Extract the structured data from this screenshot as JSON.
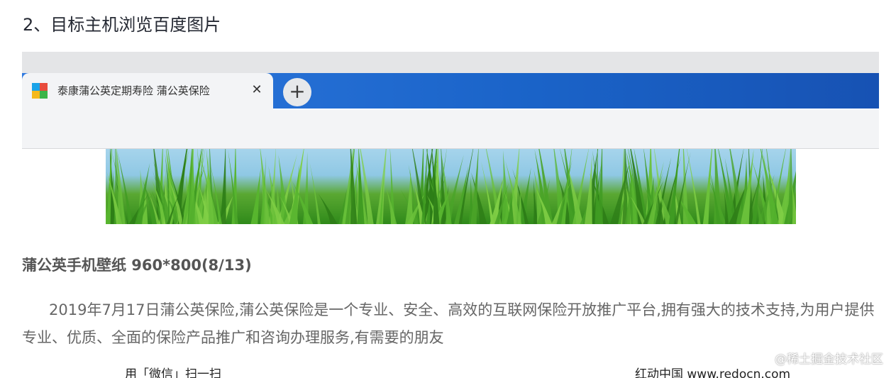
{
  "heading": "2、目标主机浏览百度图片",
  "browser": {
    "tab": {
      "title": "泰康蒲公英定期寿险 蒲公英保险",
      "close_glyph": "✕",
      "favicon_colors": [
        "#1aa3e8",
        "#e84c3d",
        "#f6b91b",
        "#3bb549"
      ]
    },
    "new_tab_glyph": "+",
    "colors": {
      "tabbar": "#1f6ad2",
      "toolbar": "#f3f4f6"
    }
  },
  "content": {
    "section_title": "蒲公英手机壁纸 960*800(8/13)",
    "paragraph": "2019年7月17日蒲公英保险,蒲公英保险是一个专业、安全、高效的互联网保险开放推广平台,拥有强大的技术支持,为用户提供专业、优质、全面的保险产品推广和咨询办理服务,有需要的朋友",
    "bottom_left": "用「微信」扫一扫",
    "bottom_right": "红动中国 www.redocn.com"
  },
  "watermark": "@稀土掘金技术社区"
}
